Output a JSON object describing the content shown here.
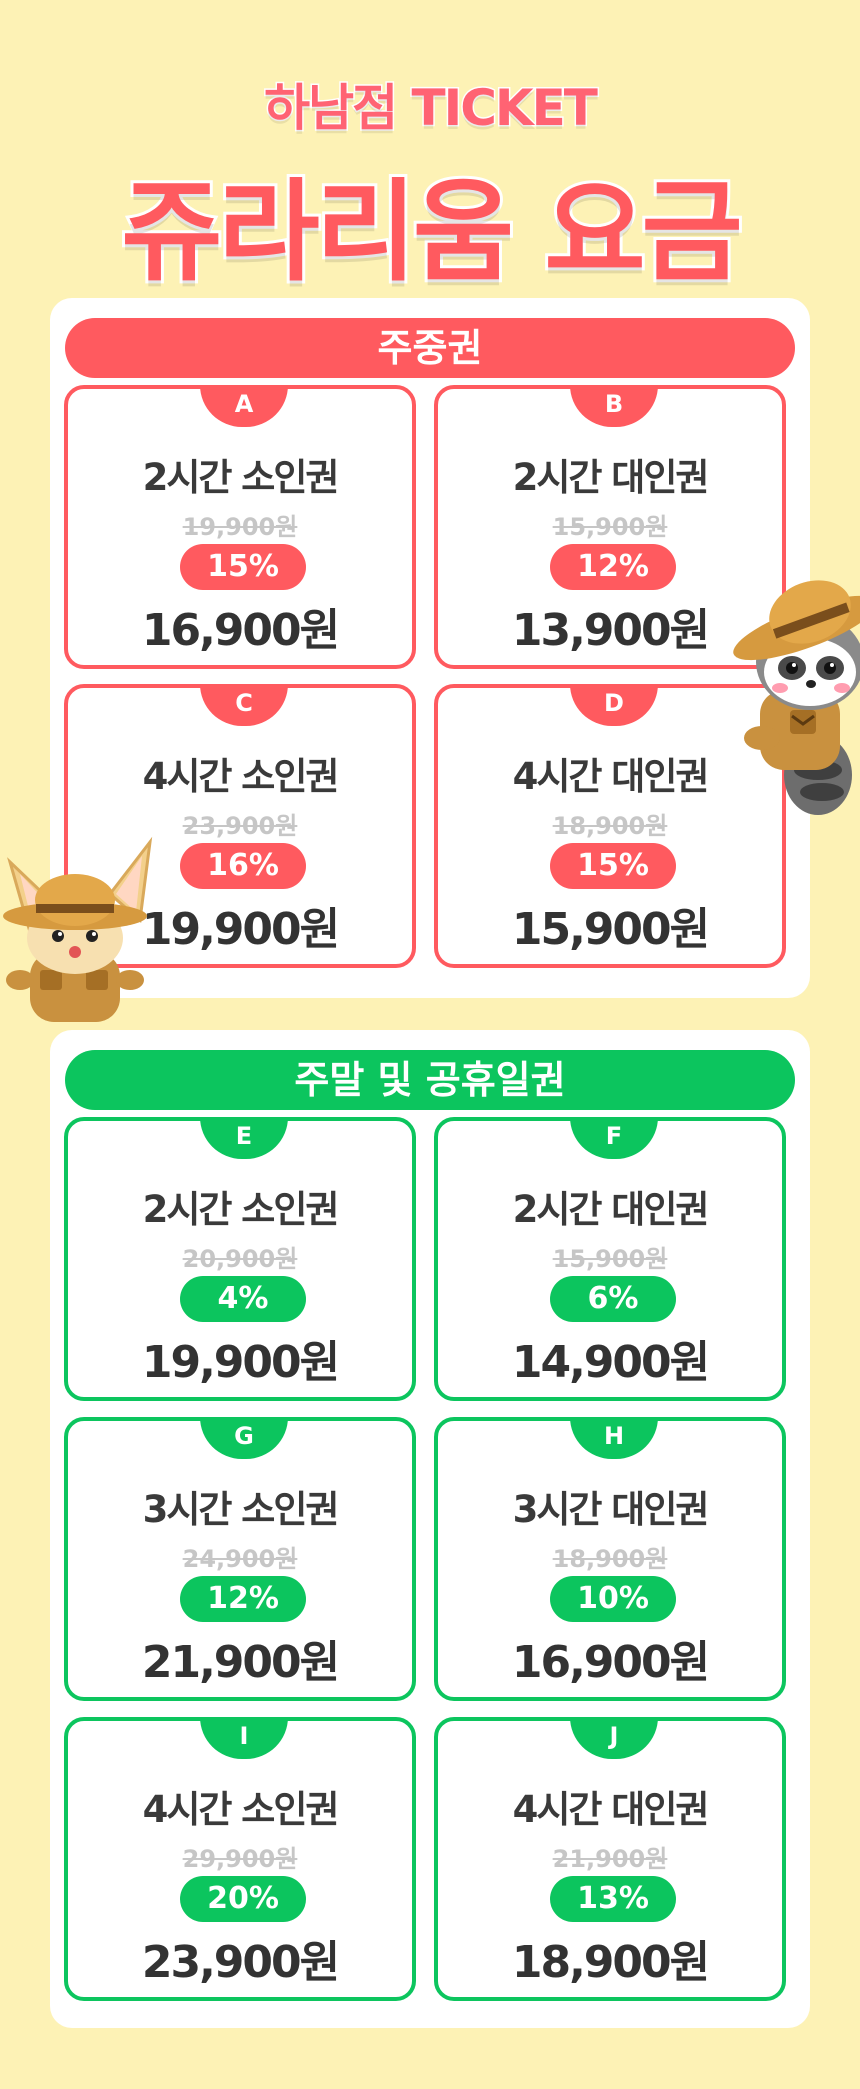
{
  "header": {
    "subtitle": "하남점 TICKET",
    "title": "쥬라리움 요금"
  },
  "weekday": {
    "label": "주중권",
    "tickets": [
      {
        "letter": "A",
        "name": "2시간 소인권",
        "original": "19,900원",
        "discount": "15%",
        "price": "16,900원"
      },
      {
        "letter": "B",
        "name": "2시간 대인권",
        "original": "15,900원",
        "discount": "12%",
        "price": "13,900원"
      },
      {
        "letter": "C",
        "name": "4시간 소인권",
        "original": "23,900원",
        "discount": "16%",
        "price": "19,900원"
      },
      {
        "letter": "D",
        "name": "4시간 대인권",
        "original": "18,900원",
        "discount": "15%",
        "price": "15,900원"
      }
    ]
  },
  "weekend": {
    "label": "주말 및 공휴일권",
    "tickets": [
      {
        "letter": "E",
        "name": "2시간 소인권",
        "original": "20,900원",
        "discount": "4%",
        "price": "19,900원"
      },
      {
        "letter": "F",
        "name": "2시간 대인권",
        "original": "15,900원",
        "discount": "6%",
        "price": "14,900원"
      },
      {
        "letter": "G",
        "name": "3시간 소인권",
        "original": "24,900원",
        "discount": "12%",
        "price": "21,900원"
      },
      {
        "letter": "H",
        "name": "3시간 대인권",
        "original": "18,900원",
        "discount": "10%",
        "price": "16,900원"
      },
      {
        "letter": "I",
        "name": "4시간 소인권",
        "original": "29,900원",
        "discount": "20%",
        "price": "23,900원"
      },
      {
        "letter": "J",
        "name": "4시간 대인권",
        "original": "21,900원",
        "discount": "13%",
        "price": "18,900원"
      }
    ]
  },
  "colors": {
    "background": "#fdf2b5",
    "weekday_accent": "#ff5a5f",
    "weekend_accent": "#0cc55e"
  },
  "mascots": {
    "right": "raccoon-explorer-mascot",
    "left": "fennec-fox-explorer-mascot"
  }
}
